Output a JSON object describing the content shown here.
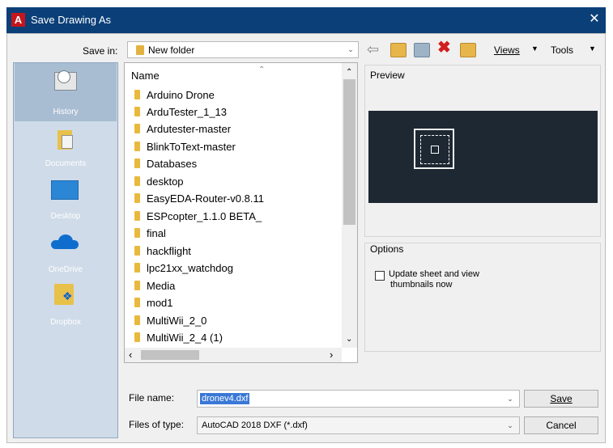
{
  "window": {
    "title": "Save Drawing As",
    "close_glyph": "✕",
    "app_icon_letter": "A"
  },
  "toolbar": {
    "save_in_label": "Save in:",
    "save_in_value": "New folder",
    "views_label": "Views",
    "tools_label": "Tools"
  },
  "places": [
    {
      "label": "History",
      "icon": "history-icon"
    },
    {
      "label": "Documents",
      "icon": "documents-icon"
    },
    {
      "label": "Desktop",
      "icon": "desktop-icon"
    },
    {
      "label": "OneDrive",
      "icon": "onedrive-icon"
    },
    {
      "label": "Dropbox",
      "icon": "dropbox-icon"
    }
  ],
  "filelist": {
    "column_name": "Name",
    "items": [
      "Arduino Drone",
      "ArduTester_1_13",
      "Ardutester-master",
      "BlinkToText-master",
      "Databases",
      "desktop",
      "EasyEDA-Router-v0.8.11",
      "ESPcopter_1.1.0 BETA_",
      "final",
      "hackflight",
      "lpc21xx_watchdog",
      "Media",
      "mod1",
      "MultiWii_2_0",
      "MultiWii_2_4 (1)"
    ]
  },
  "preview": {
    "label": "Preview"
  },
  "options": {
    "label": "Options",
    "checkbox_label_line1": "Update sheet and view",
    "checkbox_label_line2": "thumbnails now",
    "checked": false
  },
  "footer": {
    "file_name_label": "File name:",
    "file_name_value": "dronev4.dxf",
    "file_type_label": "Files of type:",
    "file_type_value": "AutoCAD 2018 DXF (*.dxf)",
    "save_button": "Save",
    "cancel_button": "Cancel"
  },
  "colors": {
    "titlebar": "#0b3f78",
    "places_bg": "#cfdbe8",
    "selection": "#3a78d6",
    "preview_bg": "#1d2833"
  }
}
